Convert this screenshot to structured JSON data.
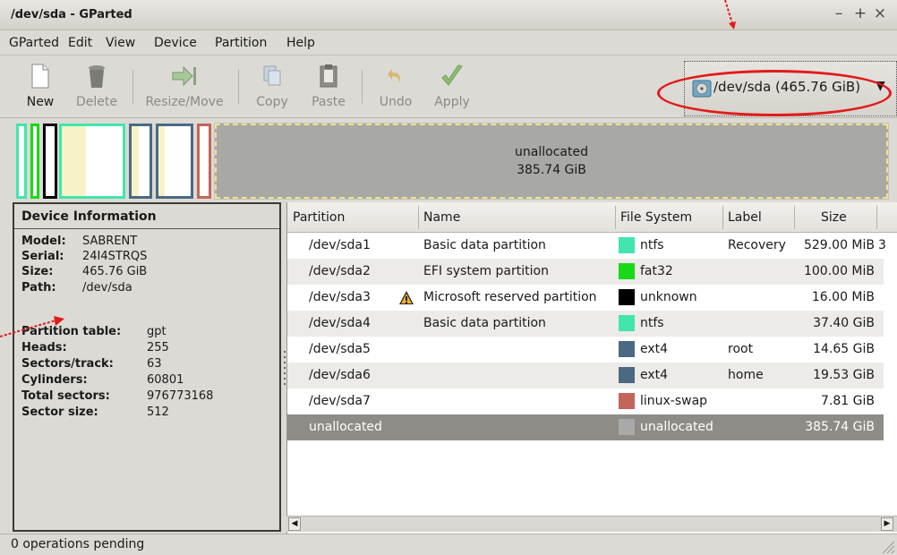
{
  "window": {
    "title": "/dev/sda - GParted",
    "min": "–",
    "max": "+",
    "close": "×"
  },
  "menu": [
    "GParted",
    "Edit",
    "View",
    "Device",
    "Partition",
    "Help"
  ],
  "toolbar": {
    "new": "New",
    "delete": "Delete",
    "resize": "Resize/Move",
    "copy": "Copy",
    "paste": "Paste",
    "undo": "Undo",
    "apply": "Apply"
  },
  "device_selector": {
    "label": "/dev/sda  (465.76 GiB)",
    "icon": "hard-disk-icon",
    "arrow": "▼"
  },
  "disk_map": {
    "unallocated_label": "unallocated",
    "unallocated_size": "385.74 GiB"
  },
  "device_info": {
    "header": "Device Information",
    "model_key": "Model:",
    "model": "SABRENT",
    "serial_key": "Serial:",
    "serial": "24I4STRQS",
    "size_key": "Size:",
    "size": "465.76 GiB",
    "path_key": "Path:",
    "path": "/dev/sda",
    "ptable_key": "Partition table:",
    "ptable": "gpt",
    "heads_key": "Heads:",
    "heads": "255",
    "sectors_key": "Sectors/track:",
    "sectors": "63",
    "cylinders_key": "Cylinders:",
    "cylinders": "60801",
    "total_key": "Total sectors:",
    "total": "976773168",
    "secsize_key": "Sector size:",
    "secsize": "512"
  },
  "table": {
    "headers": [
      "Partition",
      "Name",
      "File System",
      "Label",
      "Size"
    ],
    "rows": [
      {
        "partition": "/dev/sda1",
        "name": "Basic data partition",
        "fs": "ntfs",
        "fs_color": "#42e5ac",
        "label": "Recovery",
        "size": "529.00 MiB",
        "extra": "3"
      },
      {
        "partition": "/dev/sda2",
        "name": "EFI system partition",
        "fs": "fat32",
        "fs_color": "#18d918",
        "label": "",
        "size": "100.00 MiB",
        "extra": ""
      },
      {
        "partition": "/dev/sda3",
        "name": "Microsoft reserved partition",
        "fs": "unknown",
        "fs_color": "#000000",
        "label": "",
        "size": "16.00 MiB",
        "extra": "",
        "warning": true
      },
      {
        "partition": "/dev/sda4",
        "name": "Basic data partition",
        "fs": "ntfs",
        "fs_color": "#42e5ac",
        "label": "",
        "size": "37.40 GiB",
        "extra": ""
      },
      {
        "partition": "/dev/sda5",
        "name": "",
        "fs": "ext4",
        "fs_color": "#4b6983",
        "label": "root",
        "size": "14.65 GiB",
        "extra": ""
      },
      {
        "partition": "/dev/sda6",
        "name": "",
        "fs": "ext4",
        "fs_color": "#4b6983",
        "label": "home",
        "size": "19.53 GiB",
        "extra": ""
      },
      {
        "partition": "/dev/sda7",
        "name": "",
        "fs": "linux-swap",
        "fs_color": "#c1665a",
        "label": "",
        "size": "7.81 GiB",
        "extra": ""
      },
      {
        "partition": "unallocated",
        "name": "",
        "fs": "unallocated",
        "fs_color": "#a9a9a9",
        "label": "",
        "size": "385.74 GiB",
        "extra": "",
        "selected": true
      }
    ]
  },
  "status": "0 operations pending"
}
